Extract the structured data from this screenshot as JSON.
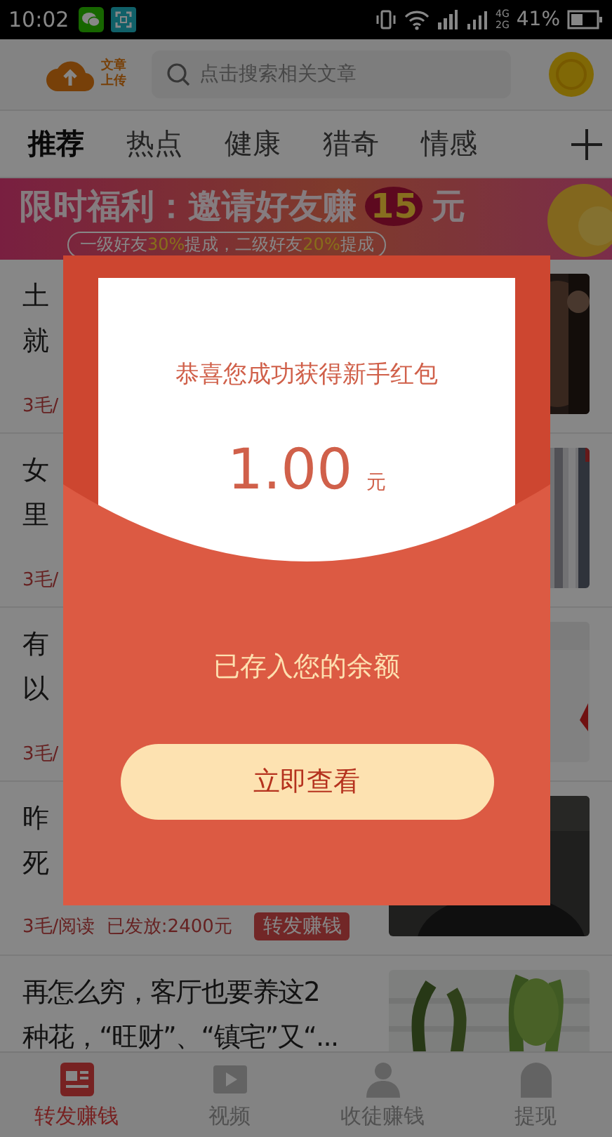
{
  "status_bar": {
    "time": "10:02",
    "network_top": "4G",
    "network_bottom": "2G",
    "battery": "41%"
  },
  "header": {
    "logo_lines": [
      "文章",
      "上传"
    ],
    "search": {
      "placeholder": "点击搜索相关文章"
    }
  },
  "tabs": [
    {
      "label": "推荐",
      "selected": true
    },
    {
      "label": "热点",
      "selected": false
    },
    {
      "label": "健康",
      "selected": false
    },
    {
      "label": "猎奇",
      "selected": false
    },
    {
      "label": "情感",
      "selected": false
    }
  ],
  "banner": {
    "headline": "限时福利：邀请好友赚",
    "amount": "15",
    "unit": "元",
    "subline": [
      {
        "text": "一级好友",
        "highlight": false
      },
      {
        "text": "30%",
        "highlight": true
      },
      {
        "text": "提成，二级好友",
        "highlight": false
      },
      {
        "text": "20%",
        "highlight": true
      },
      {
        "text": "提成",
        "highlight": false
      }
    ]
  },
  "articles": [
    {
      "title_lines": [
        "土",
        "就"
      ],
      "meta": "3毛/"
    },
    {
      "title_lines": [
        "女",
        "里"
      ],
      "meta": "3毛/"
    },
    {
      "title_lines": [
        "有",
        "以"
      ],
      "meta": "3毛/"
    },
    {
      "title_lines": [
        "昨",
        "死"
      ],
      "meta": "3毛/阅读  已发放:2400元",
      "badge": "转发赚钱"
    },
    {
      "title_lines": [
        "再怎么穷，客厅也要养这2",
        "种花，“旺财”、“镇宅”又“..."
      ]
    }
  ],
  "bottom_nav": [
    {
      "label": "转发赚钱",
      "selected": true
    },
    {
      "label": "视频",
      "selected": false
    },
    {
      "label": "收徒赚钱",
      "selected": false
    },
    {
      "label": "提现",
      "selected": false
    }
  ],
  "modal": {
    "message": "恭喜您成功获得新手红包",
    "amount": "1.00",
    "unit": "元",
    "note": "已存入您的余额",
    "button": "立即查看"
  }
}
